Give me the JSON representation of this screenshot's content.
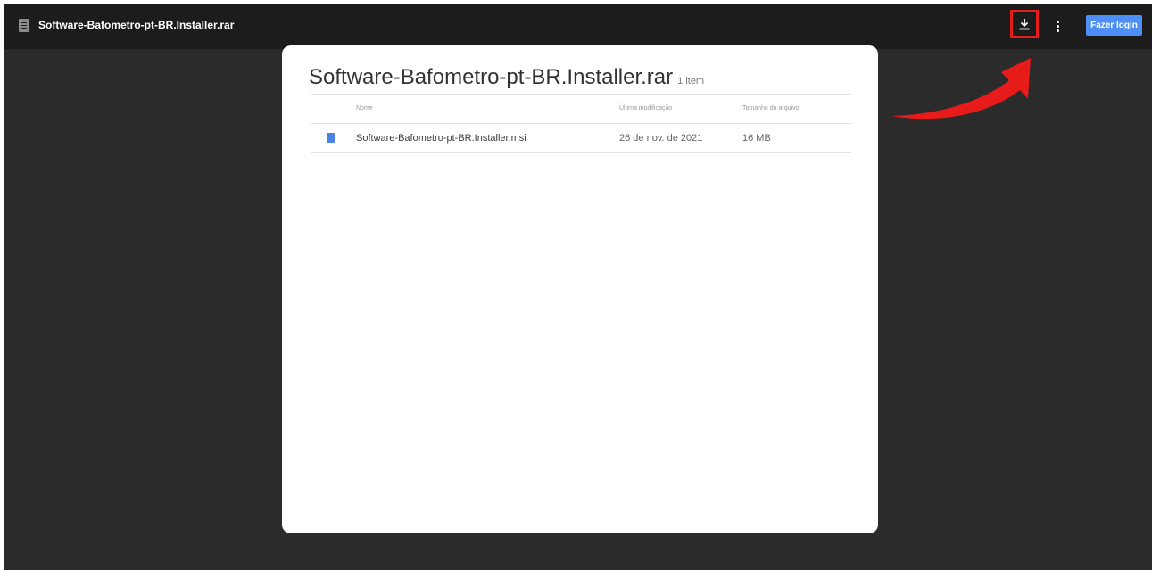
{
  "header": {
    "title": "Software-Bafometro-pt-BR.Installer.rar",
    "login_label": "Fazer login",
    "icons": [
      "document-icon",
      "download-icon",
      "more-vert-icon"
    ],
    "highlight_color": "#e81b1b",
    "accent_color": "#4d8ef7"
  },
  "archive": {
    "name": "Software-Bafometro-pt-BR.Installer.rar",
    "item_count": "1 item",
    "columns": {
      "name": "Nome",
      "modified": "Última modificação",
      "size": "Tamanho do arquivo"
    },
    "files": [
      {
        "name": "Software-Bafometro-pt-BR.Installer.msi",
        "modified": "26 de nov. de 2021",
        "size": "16 MB",
        "icon": "file-icon"
      }
    ]
  }
}
